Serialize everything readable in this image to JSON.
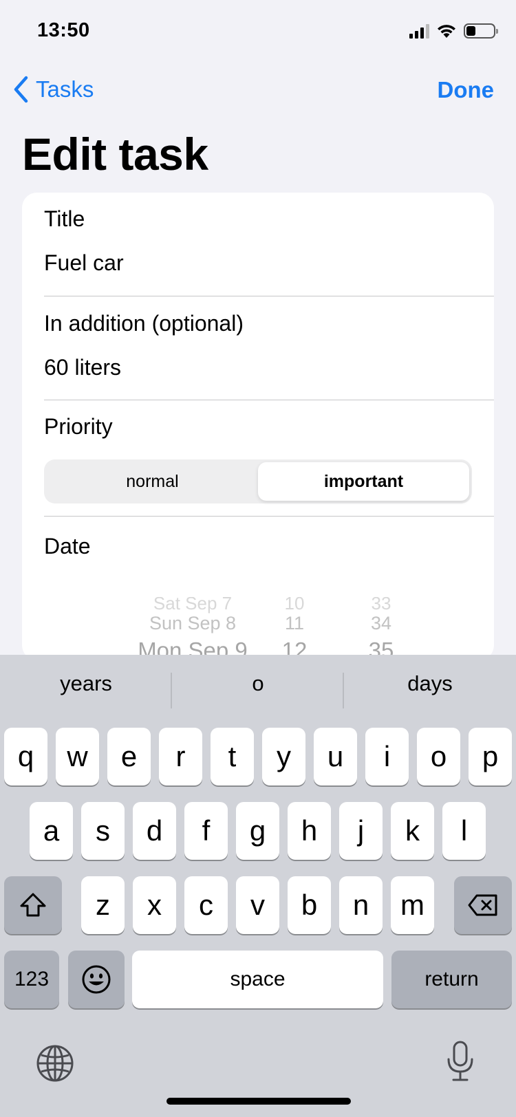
{
  "status_bar": {
    "time": "13:50"
  },
  "nav": {
    "back_label": "Tasks",
    "done_label": "Done"
  },
  "page": {
    "title": "Edit task"
  },
  "form": {
    "title_label": "Title",
    "title_value": "Fuel car",
    "addition_label": "In addition (optional)",
    "addition_value": "60 liters",
    "priority_label": "Priority",
    "priority_options": [
      "normal",
      "important"
    ],
    "priority_selected": "important",
    "date_label": "Date"
  },
  "date_picker": {
    "day_rows": [
      "Sat Sep 7",
      "Sun Sep 8",
      "Mon Sep 9"
    ],
    "hour_rows": [
      "10",
      "11",
      "12"
    ],
    "minute_rows": [
      "33",
      "34",
      "35"
    ],
    "selected_day": "Mon Sep 9",
    "selected_hour": "12",
    "selected_minute": "35"
  },
  "keyboard": {
    "suggestions": [
      "years",
      "o",
      "days"
    ],
    "row1": [
      "q",
      "w",
      "e",
      "r",
      "t",
      "y",
      "u",
      "i",
      "o",
      "p"
    ],
    "row2": [
      "a",
      "s",
      "d",
      "f",
      "g",
      "h",
      "j",
      "k",
      "l"
    ],
    "row3": [
      "z",
      "x",
      "c",
      "v",
      "b",
      "n",
      "m"
    ],
    "numbers_label": "123",
    "space_label": "space",
    "return_label": "return"
  },
  "colors": {
    "accent": "#1a7cf2",
    "background": "#f2f2f7",
    "keyboard_bg": "#d1d3d9"
  }
}
